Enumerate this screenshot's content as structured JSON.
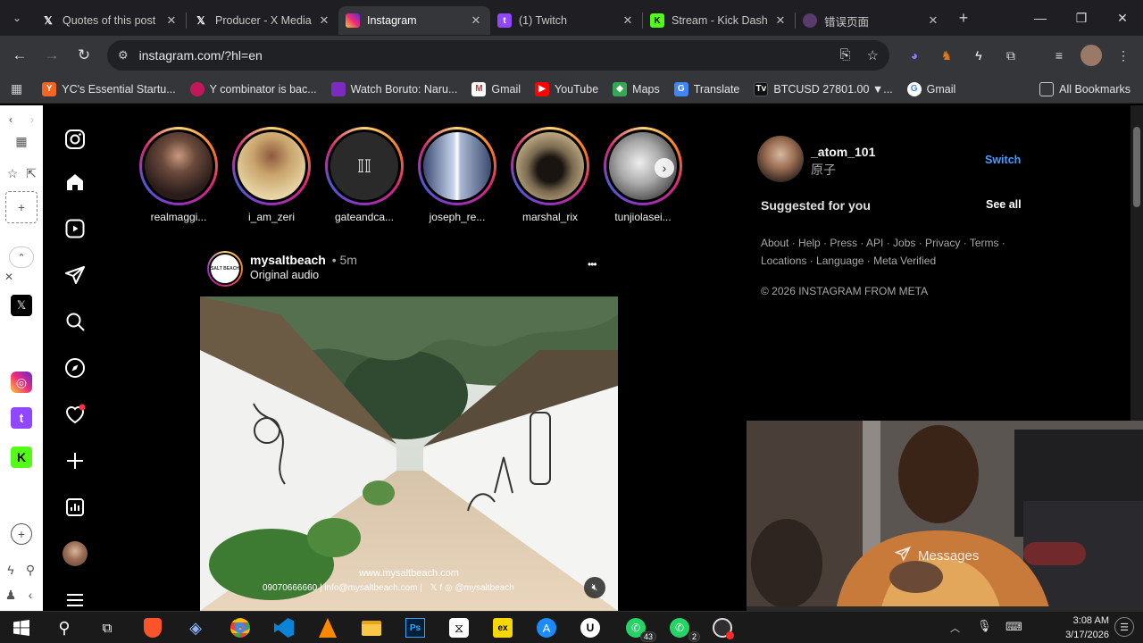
{
  "browser": {
    "tabs": [
      {
        "title": "Quotes of this post",
        "close": "✕"
      },
      {
        "title": "Producer - X Media",
        "close": "✕"
      },
      {
        "title": "Instagram",
        "close": "✕"
      },
      {
        "title": "(1) Twitch",
        "close": "✕"
      },
      {
        "title": "Stream - Kick Dash",
        "close": "✕"
      },
      {
        "title": "错误页面",
        "close": "✕"
      }
    ],
    "url": "instagram.com/?hl=en",
    "bookmarks": [
      "YC's Essential Startu...",
      "Y combinator is bac...",
      "Watch Boruto: Naru...",
      "Gmail",
      "YouTube",
      "Maps",
      "Translate",
      "BTCUSD 27801.00 ▼...",
      "Gmail"
    ],
    "all_bookmarks": "All Bookmarks"
  },
  "instagram": {
    "stories": [
      {
        "username": "realmaggi..."
      },
      {
        "username": "i_am_zeri"
      },
      {
        "username": "gateandca..."
      },
      {
        "username": "joseph_re..."
      },
      {
        "username": "marshal_rix"
      },
      {
        "username": "tunjiolasei..."
      }
    ],
    "post": {
      "username": "mysaltbeach",
      "time": "• 5m",
      "audio": "Original audio",
      "more": "•••",
      "overlay_site": "www.mysaltbeach.com",
      "overlay_contact": "09070666660 |  info@mysaltbeach.com |",
      "overlay_handle": "@mysaltbeach",
      "logo_text": "SALT BEACH"
    },
    "sidebar": {
      "account_username": "_atom_101",
      "account_name": "原子",
      "switch": "Switch",
      "suggested": "Suggested for you",
      "see_all": "See all",
      "footer_line1": "About · Help · Press · API · Jobs · Privacy · Terms ·",
      "footer_line2": "Locations · Language · Meta Verified",
      "copyright": "© 2026 INSTAGRAM FROM META"
    },
    "messages": "Messages"
  },
  "taskbar": {
    "badge_whatsapp": "43",
    "badge_whatsapp2": "2",
    "time": "3:08 AM",
    "date": "3/17/2026"
  },
  "colors": {
    "switch_blue": "#4a9bff",
    "ig_bg": "#000000",
    "chrome_bg": "#35363a"
  }
}
